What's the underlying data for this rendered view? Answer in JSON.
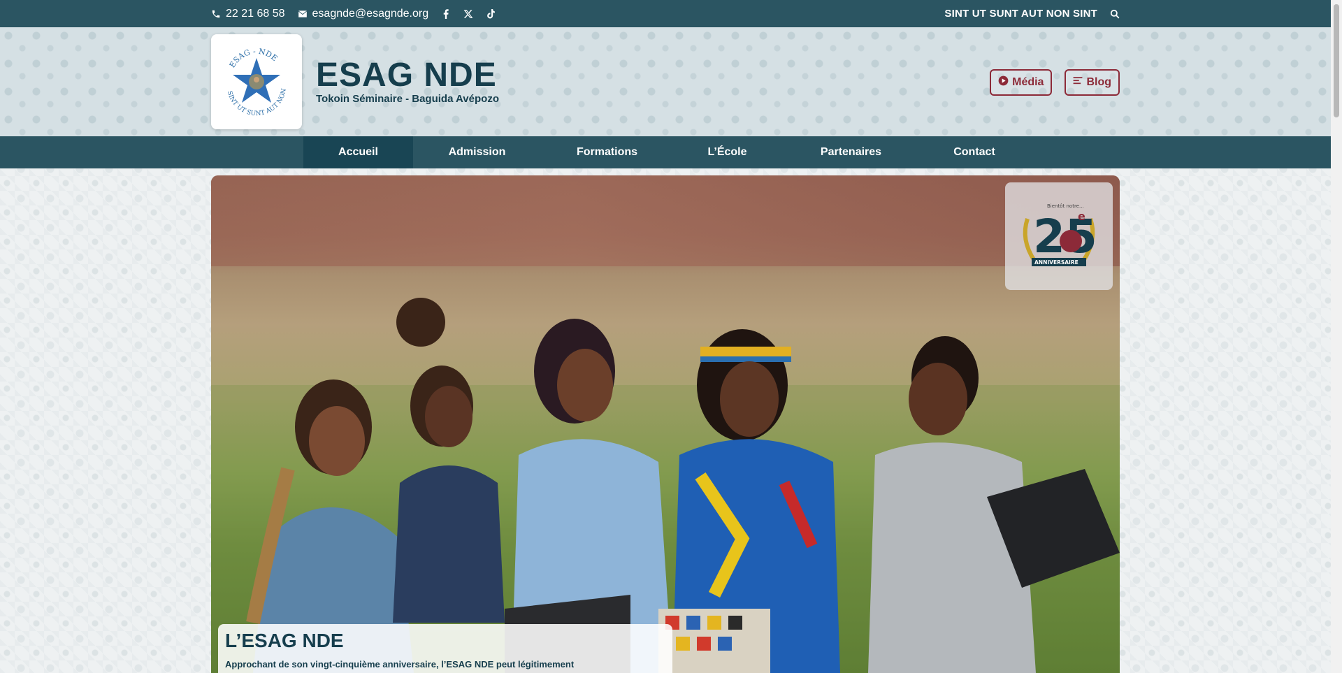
{
  "topbar": {
    "phone": "22 21 68 58",
    "email": "esagnde@esagnde.org",
    "social": [
      "facebook-icon",
      "x-icon",
      "tiktok-icon"
    ],
    "motto": "SINT UT SUNT AUT NON SINT"
  },
  "header": {
    "logo_text_top": "ESAG - NDE",
    "logo_text_bottom": "SINT UT SUNT AUT NON SINT",
    "title": "ESAG NDE",
    "subtitle": "Tokoin Séminaire - Baguida Avépozo",
    "media_label": "Média",
    "blog_label": "Blog"
  },
  "nav": {
    "items": [
      {
        "label": "Accueil",
        "active": true
      },
      {
        "label": "Admission",
        "active": false
      },
      {
        "label": "Formations",
        "active": false
      },
      {
        "label": "L’École",
        "active": false
      },
      {
        "label": "Partenaires",
        "active": false
      },
      {
        "label": "Contact",
        "active": false
      }
    ]
  },
  "hero": {
    "badge_small": "Bientôt notre...",
    "badge_number": "25",
    "badge_sup": "e",
    "badge_ribbon": "ANNIVERSAIRE",
    "caption_title": "L’ESAG NDE",
    "caption_text": "Approchant de son vingt-cinquième anniversaire, l’ESAG NDE peut légitimement"
  },
  "colors": {
    "primary": "#2b5562",
    "dark_text": "#163e4d",
    "accent": "#8c2a38"
  }
}
